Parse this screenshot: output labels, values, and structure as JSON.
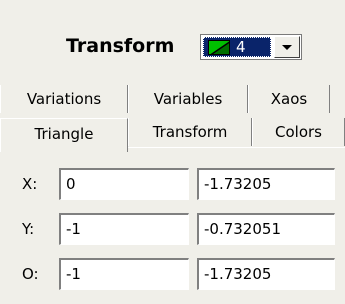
{
  "header": {
    "title": "Transform",
    "combo": {
      "selected_value": "4"
    }
  },
  "tabs_back": [
    {
      "label": "Variations"
    },
    {
      "label": "Variables"
    },
    {
      "label": "Xaos"
    }
  ],
  "tabs_front": [
    {
      "label": "Triangle",
      "active": true
    },
    {
      "label": "Transform",
      "active": false
    },
    {
      "label": "Colors",
      "active": false
    }
  ],
  "rows": [
    {
      "label": "X:",
      "value1": "0",
      "value2": "-1.73205"
    },
    {
      "label": "Y:",
      "value1": "-1",
      "value2": "-0.732051"
    },
    {
      "label": "O:",
      "value1": "-1",
      "value2": "-1.73205"
    }
  ],
  "colors": {
    "panel_bg": "#f0efe9",
    "selection": "#0a246a",
    "swatch_green": "#00c000"
  },
  "icons": {
    "combo_swatch": "triangle-swatch-icon",
    "combo_arrow": "chevron-down-icon"
  }
}
